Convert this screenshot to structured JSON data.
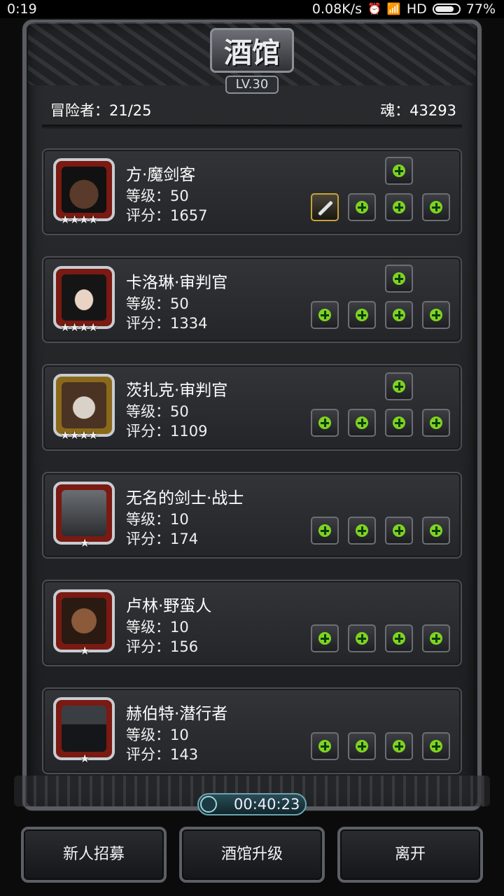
{
  "status_bar": {
    "time": "0:19",
    "speed": "0.08K/s",
    "network": "HD",
    "battery": "77%"
  },
  "header": {
    "title": "酒馆",
    "level": "LV.30"
  },
  "info": {
    "adventurers": "冒险者：21/25",
    "soul": "魂：43293"
  },
  "heroes": [
    {
      "name": "方·魔剑客",
      "level": "等级：50",
      "score": "评分：1657",
      "stars": "★★★★",
      "frame": "red"
    },
    {
      "name": "卡洛琳·审判官",
      "level": "等级：50",
      "score": "评分：1334",
      "stars": "★★★★",
      "frame": "red"
    },
    {
      "name": "茨扎克·审判官",
      "level": "等级：50",
      "score": "评分：1109",
      "stars": "★★★★",
      "frame": "gold"
    },
    {
      "name": "无名的剑士·战士",
      "level": "等级：10",
      "score": "评分：174",
      "stars": "★",
      "frame": "red"
    },
    {
      "name": "卢林·野蛮人",
      "level": "等级：10",
      "score": "评分：156",
      "stars": "★",
      "frame": "red"
    },
    {
      "name": "赫伯特·潜行者",
      "level": "等级：10",
      "score": "评分：143",
      "stars": "★",
      "frame": "red"
    }
  ],
  "timer": "00:40:23",
  "buttons": {
    "recruit": "新人招募",
    "upgrade": "酒馆升级",
    "leave": "离开"
  },
  "colors": {
    "accent_green": "#7ed321",
    "frame_red": "#7a1a12",
    "frame_gold": "#8a6a1a"
  }
}
